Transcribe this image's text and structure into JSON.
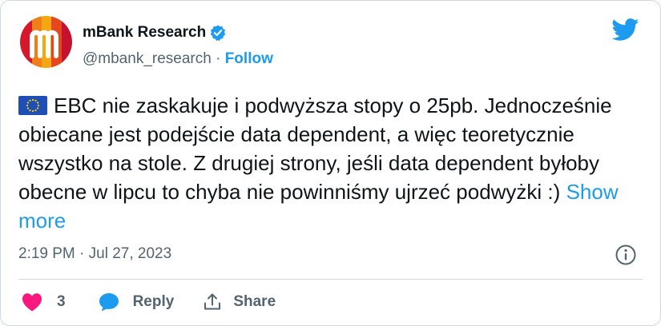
{
  "author": {
    "name": "mBank Research",
    "handle": "@mbank_research",
    "separator": "·",
    "follow_label": "Follow",
    "avatar_icon": "mbank-logo-icon",
    "verified_icon": "verified-badge-icon"
  },
  "platform_icon": "twitter-bird-icon",
  "tweet": {
    "flag_icon": "eu-flag-icon",
    "text": "EBC nie zaskakuje i podwyższa stopy o 25pb. Jednocześnie obiecane jest podejście data dependent, a więc teoretycznie wszystko na stole. Z drugiej strony, jeśli data dependent byłoby obecne w lipcu to chyba nie powinniśmy ujrzeć podwyżki :)",
    "show_more_label": "Show more"
  },
  "meta": {
    "timestamp": "2:19 PM · Jul 27, 2023",
    "info_icon": "info-icon"
  },
  "actions": {
    "like_count": "3",
    "reply_label": "Reply",
    "share_label": "Share"
  },
  "colors": {
    "accent": "#1d9bf0",
    "like": "#f91880",
    "text_primary": "#0f1419",
    "text_secondary": "#536471",
    "border": "#cfd9de"
  }
}
